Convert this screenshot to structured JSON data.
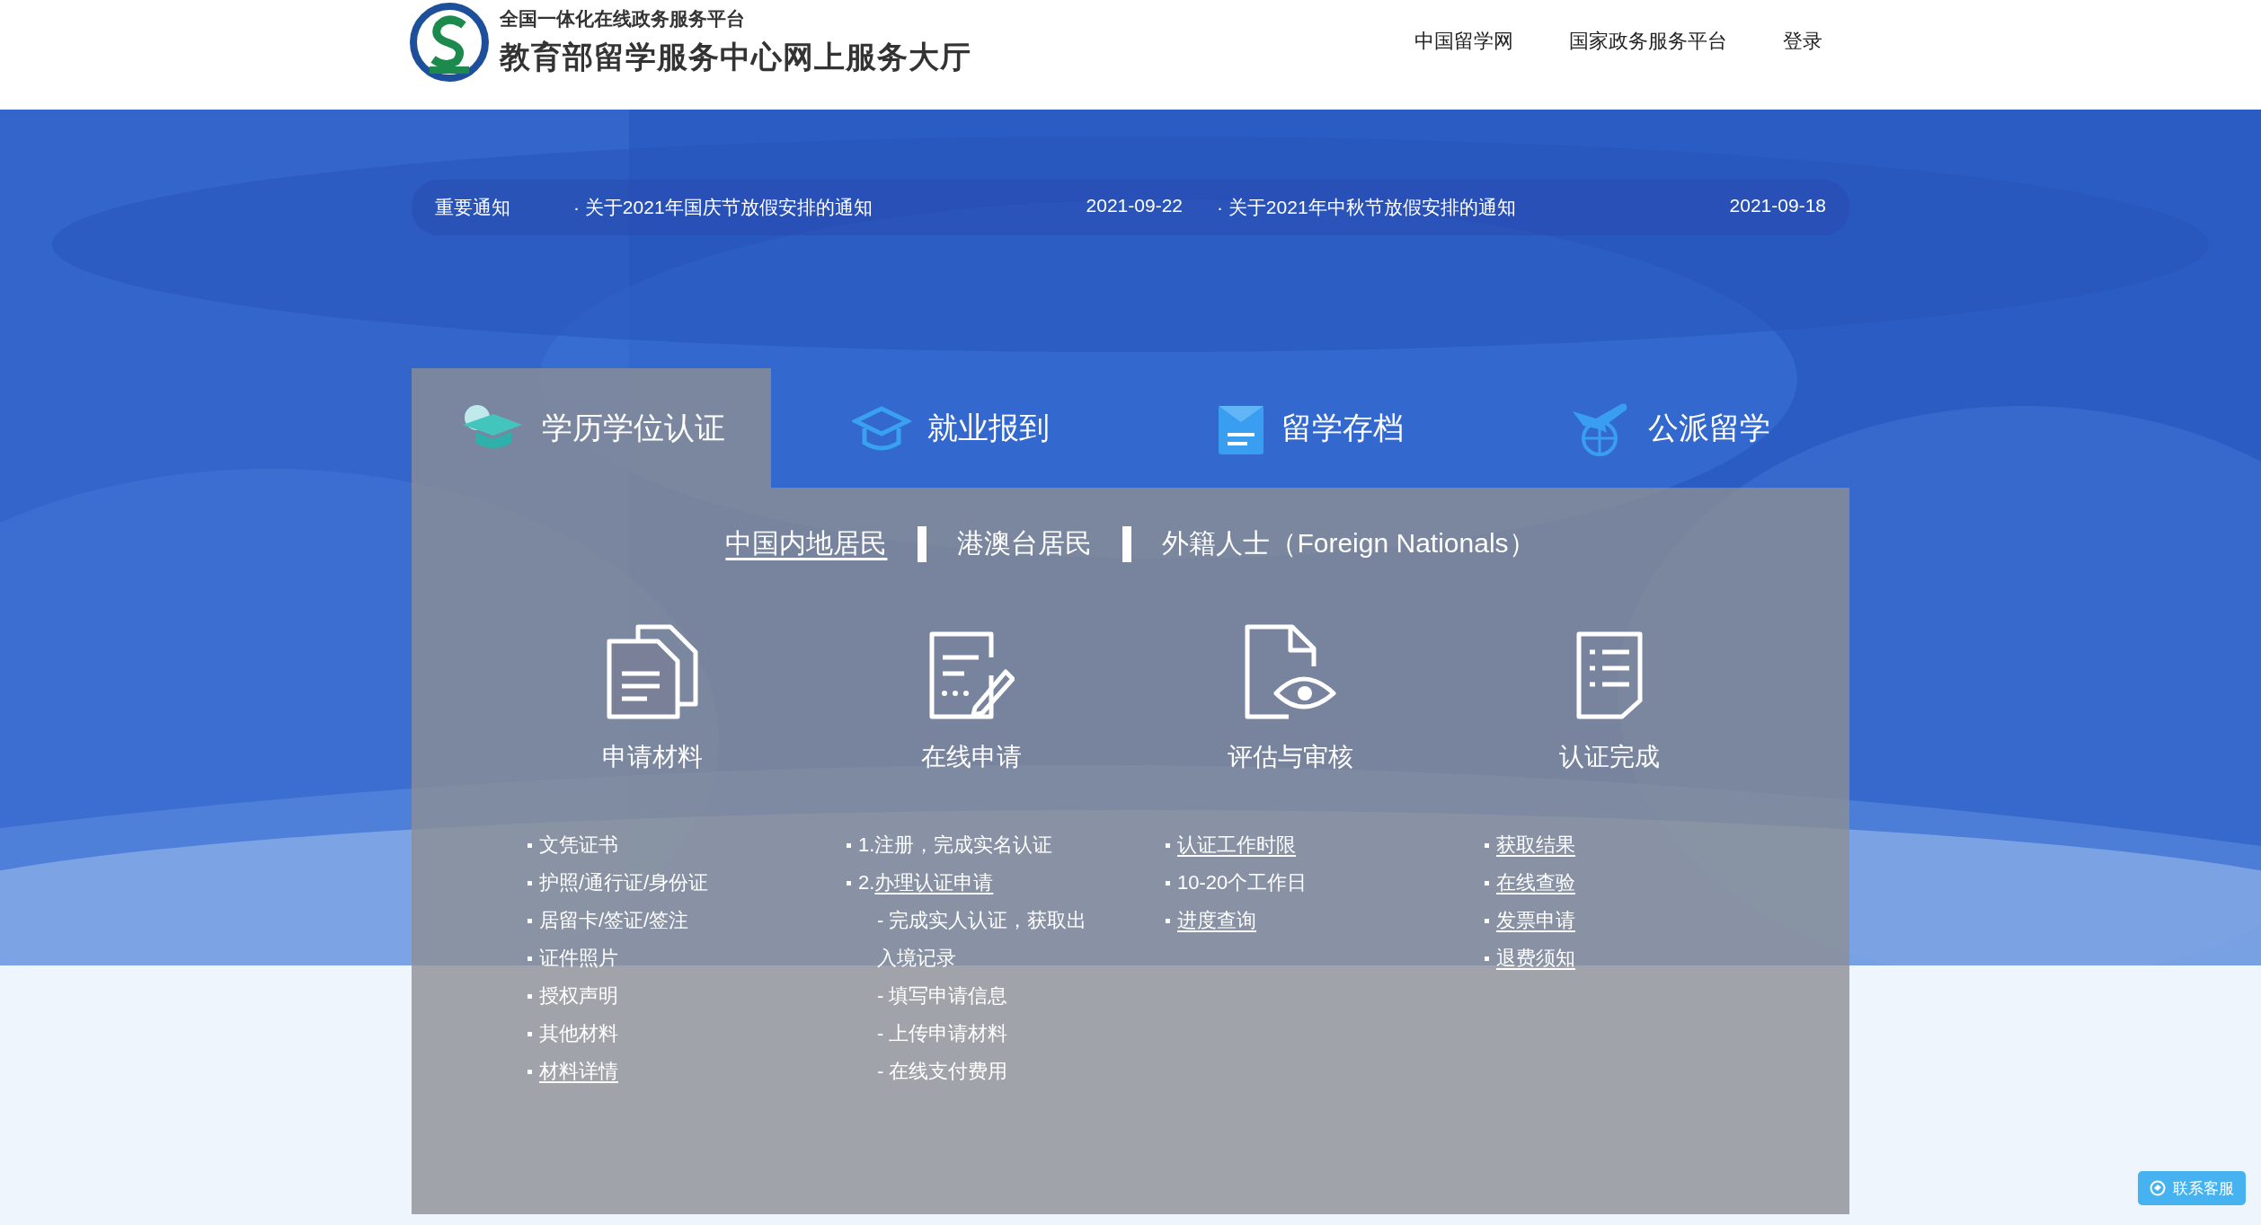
{
  "header": {
    "subtitle": "全国一体化在线政务服务平台",
    "title": "教育部留学服务中心网上服务大厅",
    "nav": [
      "中国留学网",
      "国家政务服务平台",
      "登录"
    ]
  },
  "notices": {
    "label": "重要通知",
    "items": [
      {
        "bullet": "·",
        "title": "关于2021年国庆节放假安排的通知",
        "date": "2021-09-22"
      },
      {
        "bullet": "·",
        "title": "关于2021年中秋节放假安排的通知",
        "date": "2021-09-18"
      }
    ]
  },
  "tabs": [
    {
      "label": "学历学位认证",
      "kind": "degree",
      "selected": true
    },
    {
      "label": "就业报到",
      "kind": "employment",
      "selected": false
    },
    {
      "label": "留学存档",
      "kind": "archive",
      "selected": false
    },
    {
      "label": "公派留学",
      "kind": "abroad",
      "selected": false
    }
  ],
  "audience_tabs": [
    {
      "label": "中国内地居民",
      "selected": true
    },
    {
      "label": "港澳台居民",
      "selected": false
    },
    {
      "label": "外籍人士（Foreign Nationals）",
      "selected": false
    }
  ],
  "steps": [
    {
      "title": "申请材料",
      "kind": "materials",
      "items": [
        {
          "kind": "bullet",
          "text": "文凭证书",
          "link": false
        },
        {
          "kind": "bullet",
          "text": "护照/通行证/身份证",
          "link": false
        },
        {
          "kind": "bullet",
          "text": "居留卡/签证/签注",
          "link": false
        },
        {
          "kind": "bullet",
          "text": "证件照片",
          "link": false
        },
        {
          "kind": "bullet",
          "text": "授权声明",
          "link": false
        },
        {
          "kind": "bullet",
          "text": "其他材料",
          "link": false
        },
        {
          "kind": "bullet",
          "text": "材料详情",
          "link": true
        }
      ]
    },
    {
      "title": "在线申请",
      "kind": "apply",
      "items": [
        {
          "kind": "bullet",
          "text": "1.注册，完成实名认证",
          "link": false
        },
        {
          "kind": "bullet",
          "prefix": "2.",
          "text": "办理认证申请",
          "link": true
        },
        {
          "kind": "sub",
          "text": "- 完成实人认证，获取出",
          "link": false
        },
        {
          "kind": "sub",
          "text": "入境记录",
          "link": false
        },
        {
          "kind": "sub",
          "text": "- 填写申请信息",
          "link": false
        },
        {
          "kind": "sub",
          "text": "- 上传申请材料",
          "link": false
        },
        {
          "kind": "sub",
          "text": "- 在线支付费用",
          "link": false
        }
      ]
    },
    {
      "title": "评估与审核",
      "kind": "review",
      "items": [
        {
          "kind": "bullet",
          "text": "认证工作时限",
          "link": true
        },
        {
          "kind": "bullet",
          "text": "10-20个工作日",
          "link": false
        },
        {
          "kind": "bullet",
          "text": "进度查询",
          "link": true
        }
      ]
    },
    {
      "title": "认证完成",
      "kind": "done",
      "items": [
        {
          "kind": "bullet",
          "text": "获取结果",
          "link": true
        },
        {
          "kind": "bullet",
          "text": "在线查验",
          "link": true
        },
        {
          "kind": "bullet",
          "text": "发票申请",
          "link": true
        },
        {
          "kind": "bullet",
          "text": "退费须知",
          "link": true
        }
      ]
    }
  ],
  "support_button": {
    "label": "联系客服"
  }
}
